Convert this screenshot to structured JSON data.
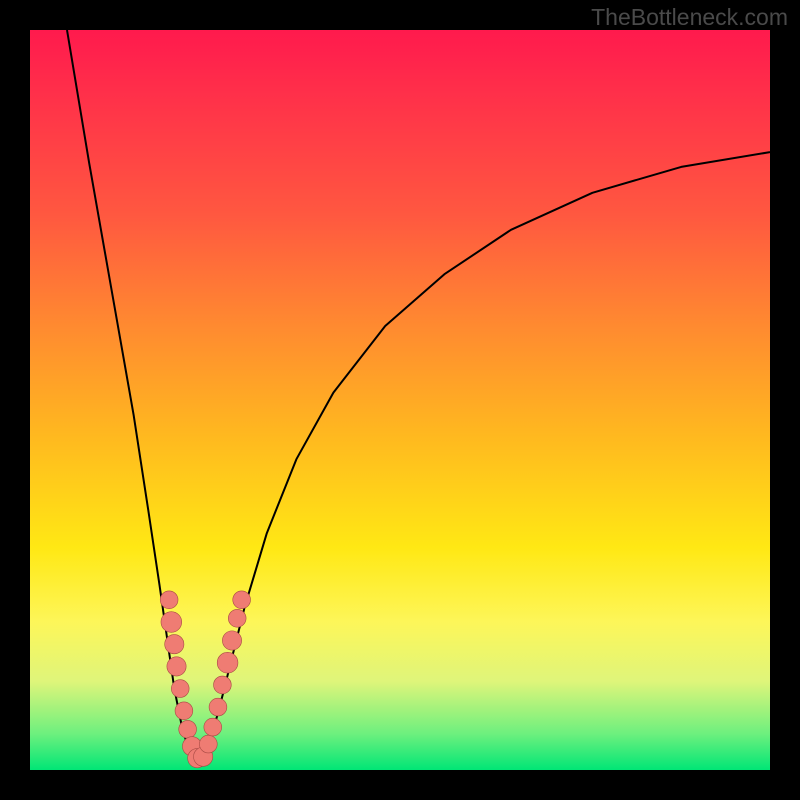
{
  "watermark": "TheBottleneck.com",
  "colors": {
    "frame": "#000000",
    "gradient_top": "#ff1a4d",
    "gradient_mid_upper": "#ff8a30",
    "gradient_mid": "#ffe814",
    "gradient_mid_lower": "#dff57a",
    "gradient_bottom": "#00e676",
    "curve_stroke": "#000000",
    "marker_fill": "#ef7c73",
    "marker_stroke": "#a84a44"
  },
  "chart_data": {
    "type": "line",
    "title": "",
    "xlabel": "",
    "ylabel": "",
    "xlim": [
      0,
      100
    ],
    "ylim": [
      0,
      100
    ],
    "grid": false,
    "legend": false,
    "curves": [
      {
        "name": "left-branch",
        "points": [
          {
            "x": 5,
            "y": 100
          },
          {
            "x": 8,
            "y": 82
          },
          {
            "x": 11,
            "y": 65
          },
          {
            "x": 14,
            "y": 48
          },
          {
            "x": 16,
            "y": 35
          },
          {
            "x": 17.5,
            "y": 25
          },
          {
            "x": 18.5,
            "y": 18
          },
          {
            "x": 19.5,
            "y": 11
          },
          {
            "x": 20.5,
            "y": 6
          },
          {
            "x": 21.5,
            "y": 2.5
          },
          {
            "x": 22.5,
            "y": 0.8
          }
        ]
      },
      {
        "name": "right-branch",
        "points": [
          {
            "x": 22.5,
            "y": 0.8
          },
          {
            "x": 24,
            "y": 3
          },
          {
            "x": 25.5,
            "y": 8
          },
          {
            "x": 27,
            "y": 14
          },
          {
            "x": 29,
            "y": 22
          },
          {
            "x": 32,
            "y": 32
          },
          {
            "x": 36,
            "y": 42
          },
          {
            "x": 41,
            "y": 51
          },
          {
            "x": 48,
            "y": 60
          },
          {
            "x": 56,
            "y": 67
          },
          {
            "x": 65,
            "y": 73
          },
          {
            "x": 76,
            "y": 78
          },
          {
            "x": 88,
            "y": 81.5
          },
          {
            "x": 100,
            "y": 83.5
          }
        ]
      }
    ],
    "markers": [
      {
        "x": 18.8,
        "y": 23,
        "r": 1.2
      },
      {
        "x": 19.1,
        "y": 20,
        "r": 1.4
      },
      {
        "x": 19.5,
        "y": 17,
        "r": 1.3
      },
      {
        "x": 19.8,
        "y": 14,
        "r": 1.3
      },
      {
        "x": 20.3,
        "y": 11,
        "r": 1.2
      },
      {
        "x": 20.8,
        "y": 8,
        "r": 1.2
      },
      {
        "x": 21.3,
        "y": 5.5,
        "r": 1.2
      },
      {
        "x": 21.9,
        "y": 3.2,
        "r": 1.3
      },
      {
        "x": 22.6,
        "y": 1.6,
        "r": 1.3
      },
      {
        "x": 23.4,
        "y": 1.8,
        "r": 1.3
      },
      {
        "x": 24.1,
        "y": 3.5,
        "r": 1.2
      },
      {
        "x": 24.7,
        "y": 5.8,
        "r": 1.2
      },
      {
        "x": 25.4,
        "y": 8.5,
        "r": 1.2
      },
      {
        "x": 26.0,
        "y": 11.5,
        "r": 1.2
      },
      {
        "x": 26.7,
        "y": 14.5,
        "r": 1.4
      },
      {
        "x": 27.3,
        "y": 17.5,
        "r": 1.3
      },
      {
        "x": 28.0,
        "y": 20.5,
        "r": 1.2
      },
      {
        "x": 28.6,
        "y": 23,
        "r": 1.2
      }
    ]
  }
}
